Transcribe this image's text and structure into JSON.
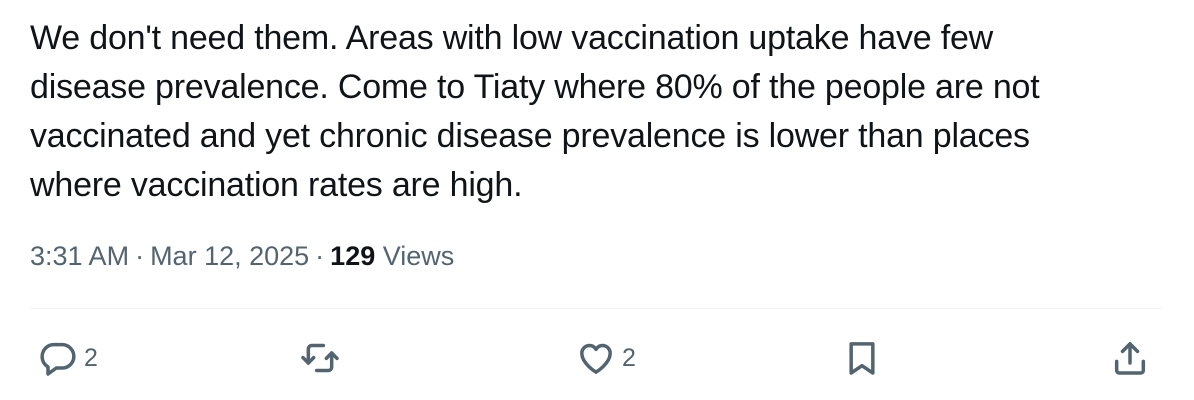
{
  "tweet": {
    "text_lines": [
      "We don't need them. Areas with low vaccination uptake have few",
      "disease prevalence. Come to Tiaty where 80% of the people are not",
      "vaccinated and yet chronic disease prevalence is lower than places",
      "where vaccination rates are high."
    ],
    "time": "3:31 AM",
    "separator": "·",
    "date": "Mar 12, 2025",
    "views_count": "129",
    "views_label": "Views"
  },
  "actions": {
    "reply": {
      "icon": "reply-icon",
      "count": "2"
    },
    "retweet": {
      "icon": "retweet-icon"
    },
    "like": {
      "icon": "heart-icon",
      "count": "2"
    },
    "bookmark": {
      "icon": "bookmark-icon"
    },
    "share": {
      "icon": "share-icon"
    }
  },
  "colors": {
    "text": "#0f1419",
    "secondary": "#536471",
    "divider": "#eff3f4",
    "background": "#ffffff"
  }
}
